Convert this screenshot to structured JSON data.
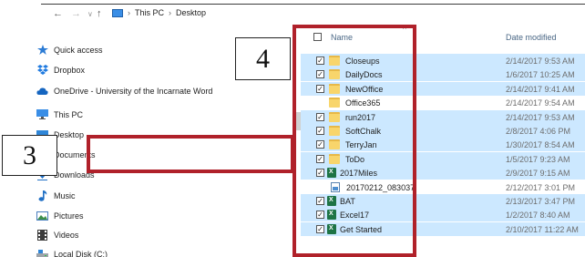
{
  "addressbar": {
    "back_icon": "arrow-left-icon",
    "forward_icon": "arrow-right-icon",
    "recent_icon": "chevron-down-icon",
    "up_icon": "arrow-up-icon",
    "crumbs": [
      "This PC",
      "Desktop"
    ],
    "separator": "›"
  },
  "sidebar": {
    "items": [
      {
        "label": "Quick access",
        "icon": "star-icon"
      },
      {
        "label": "Dropbox",
        "icon": "dropbox-icon"
      },
      {
        "label": "OneDrive - University of the Incarnate Word",
        "icon": "cloud-icon"
      },
      {
        "label": "This PC",
        "icon": "computer-icon"
      },
      {
        "label": "Desktop",
        "icon": "desktop-icon"
      },
      {
        "label": "Documents",
        "icon": "documents-icon"
      },
      {
        "label": "Downloads",
        "icon": "download-icon"
      },
      {
        "label": "Music",
        "icon": "music-icon"
      },
      {
        "label": "Pictures",
        "icon": "pictures-icon"
      },
      {
        "label": "Videos",
        "icon": "videos-icon"
      },
      {
        "label": "Local Disk (C:)",
        "icon": "disk-icon"
      }
    ]
  },
  "filelist": {
    "headers": {
      "name": "Name",
      "date": "Date modified"
    },
    "rows": [
      {
        "name": "Closeups",
        "date": "2/14/2017 9:53 AM",
        "type": "folder",
        "selected": true
      },
      {
        "name": "DailyDocs",
        "date": "1/6/2017 10:25 AM",
        "type": "folder",
        "selected": true
      },
      {
        "name": "NewOffice",
        "date": "2/14/2017 9:41 AM",
        "type": "folder",
        "selected": true
      },
      {
        "name": "Office365",
        "date": "2/14/2017 9:54 AM",
        "type": "folder",
        "selected": false
      },
      {
        "name": "run2017",
        "date": "2/14/2017 9:53 AM",
        "type": "folder",
        "selected": true
      },
      {
        "name": "SoftChalk",
        "date": "2/8/2017 4:06 PM",
        "type": "folder",
        "selected": true
      },
      {
        "name": "TerryJan",
        "date": "1/30/2017 8:54 AM",
        "type": "folder",
        "selected": true
      },
      {
        "name": "ToDo",
        "date": "1/5/2017 9:23 AM",
        "type": "folder",
        "selected": true
      },
      {
        "name": "2017Miles",
        "date": "2/9/2017 9:15 AM",
        "type": "excel",
        "selected": true
      },
      {
        "name": "20170212_083037",
        "date": "2/12/2017 3:01 PM",
        "type": "image",
        "selected": false
      },
      {
        "name": "BAT",
        "date": "2/13/2017 3:47 PM",
        "type": "excel",
        "selected": true
      },
      {
        "name": "Excel17",
        "date": "1/2/2017 8:40 AM",
        "type": "excel",
        "selected": true
      },
      {
        "name": "Get Started",
        "date": "2/10/2017 11:22 AM",
        "type": "excel",
        "selected": true
      }
    ]
  },
  "annotations": {
    "callout_3": "3",
    "callout_4": "4",
    "highlight_color": "#b0212a"
  },
  "colors": {
    "selection": "#cce8ff",
    "header_text": "#4a6785",
    "date_text": "#6d6d6d"
  }
}
